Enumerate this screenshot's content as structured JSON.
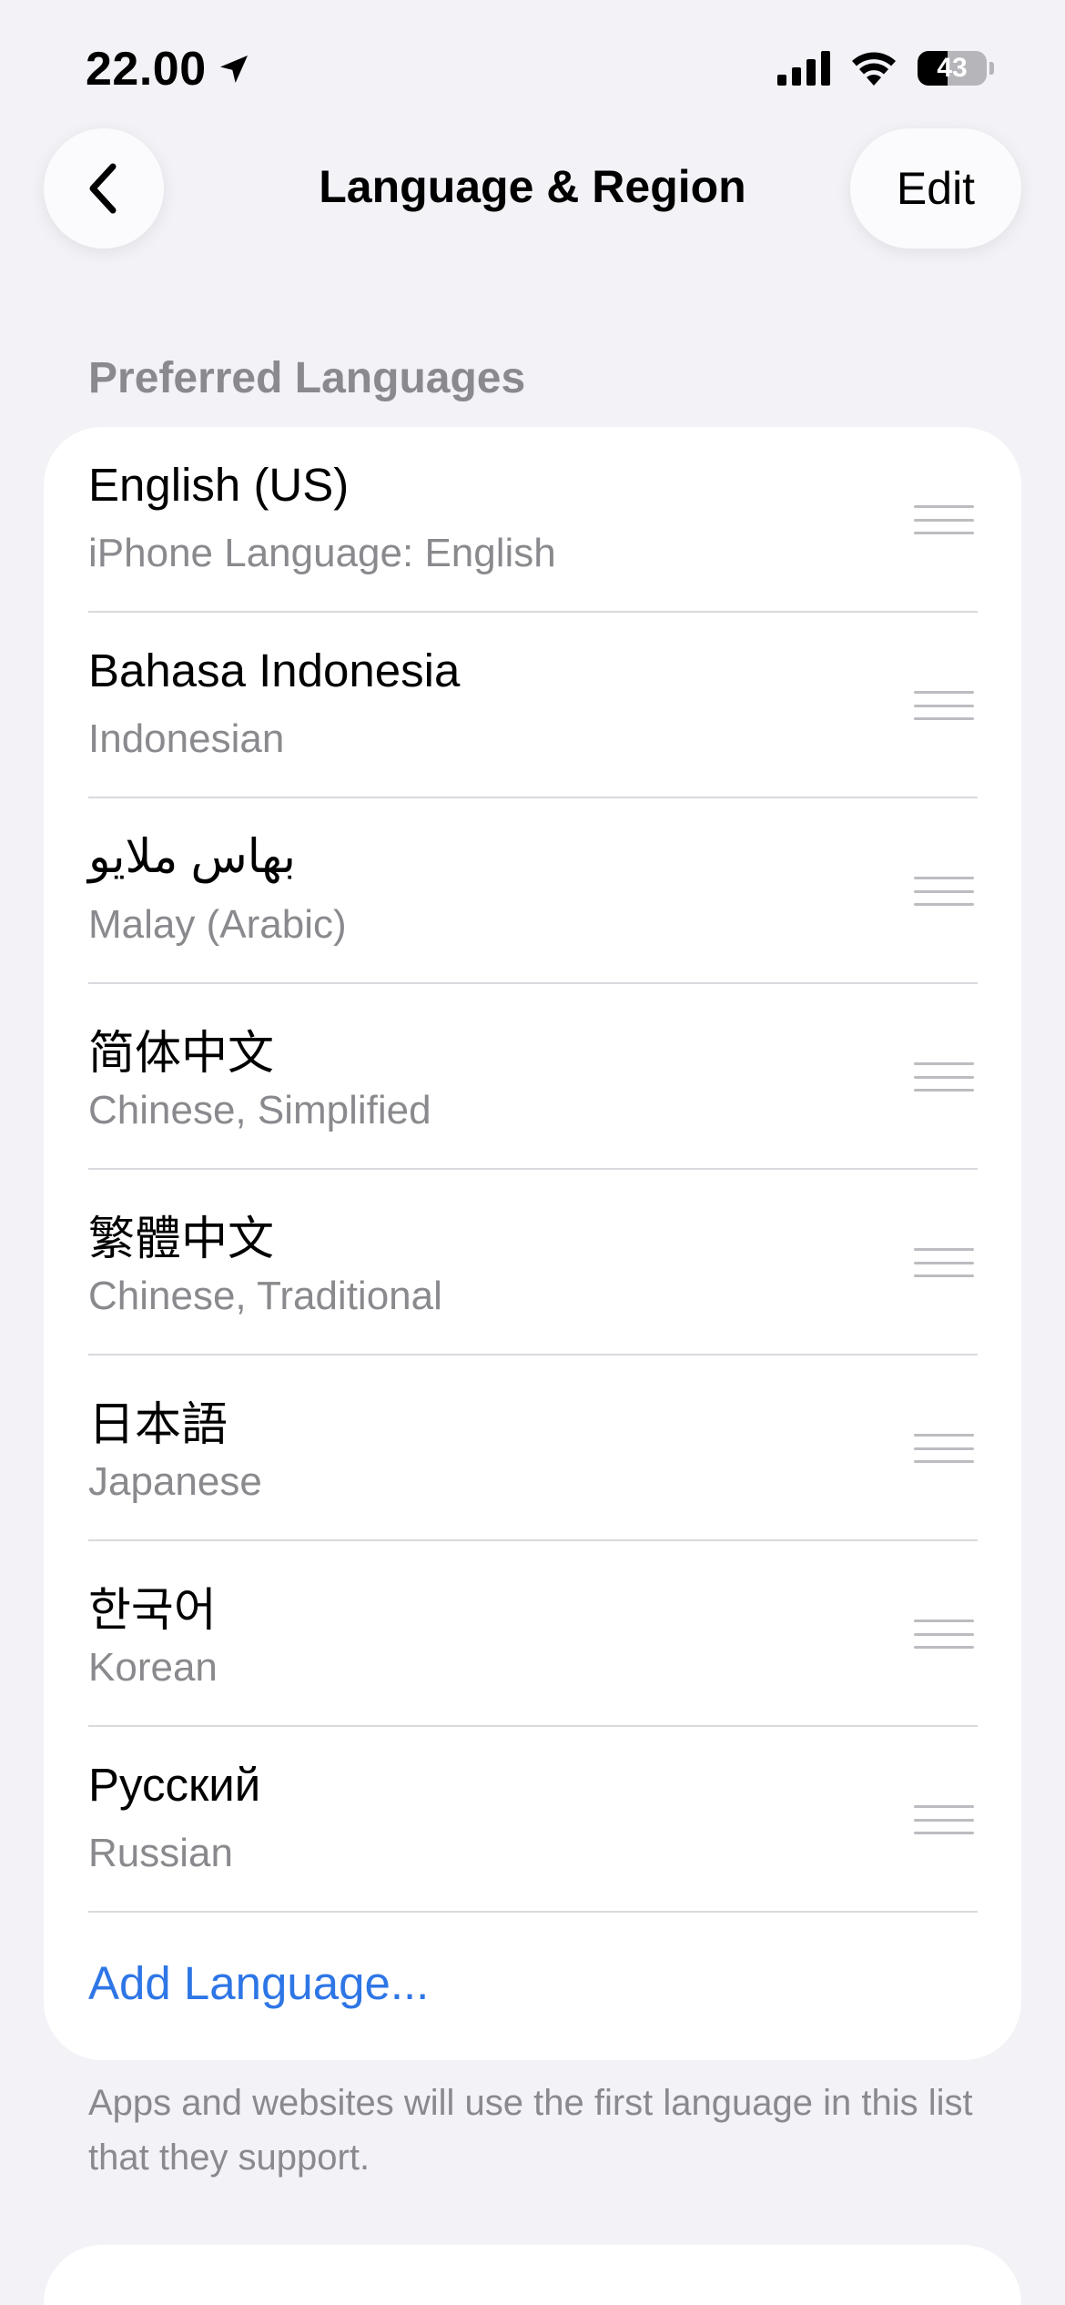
{
  "status_bar": {
    "time": "22.00",
    "battery_percent": "43",
    "battery_level": 0.43,
    "icons": [
      "location-arrow-icon",
      "cellular-signal-icon",
      "wifi-icon",
      "battery-icon"
    ]
  },
  "nav": {
    "back_icon": "chevron-left-icon",
    "title": "Language & Region",
    "edit_label": "Edit"
  },
  "preferred_languages": {
    "header": "Preferred Languages",
    "items": [
      {
        "primary": "English (US)",
        "secondary": "iPhone Language: English"
      },
      {
        "primary": "Bahasa Indonesia",
        "secondary": "Indonesian"
      },
      {
        "primary": "بهاس ملايو",
        "secondary": "Malay (Arabic)"
      },
      {
        "primary": "简体中文",
        "secondary": "Chinese, Simplified"
      },
      {
        "primary": "繁體中文",
        "secondary": "Chinese, Traditional"
      },
      {
        "primary": "日本語",
        "secondary": "Japanese"
      },
      {
        "primary": "한국어",
        "secondary": "Korean"
      },
      {
        "primary": "Русский",
        "secondary": "Russian"
      }
    ],
    "add_label": "Add Language...",
    "footer": "Apps and websites will use the first language in this list that they support."
  },
  "colors": {
    "background": "#f2f2f7",
    "card": "#ffffff",
    "secondary_text": "#8a8a8e",
    "link": "#2e76e6"
  }
}
